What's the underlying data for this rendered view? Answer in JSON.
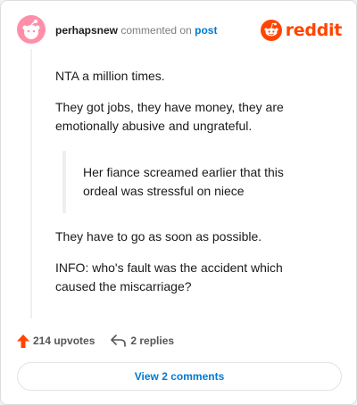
{
  "comment": {
    "author": "perhapsnew",
    "action_text": "commented on",
    "target_text": "post",
    "brand": "reddit",
    "paragraphs": [
      "NTA a million times.",
      "They got jobs, they have money, they are emotionally abusive and ungrateful.",
      "They have to go as soon as possible.",
      "INFO: who's fault was the accident which caused the miscarriage?"
    ],
    "quote": "Her fiance screamed earlier that this ordeal was stressful on niece"
  },
  "footer": {
    "upvotes": "214 upvotes",
    "replies": "2 replies"
  },
  "view_button": "View 2 comments",
  "colors": {
    "brand_orange": "#ff4500",
    "link_blue": "#0079d3",
    "avatar_bg": "#ff8fa9"
  },
  "icons": [
    "avatar-snoo",
    "reddit-logo",
    "upvote-arrow",
    "reply-arrow"
  ]
}
